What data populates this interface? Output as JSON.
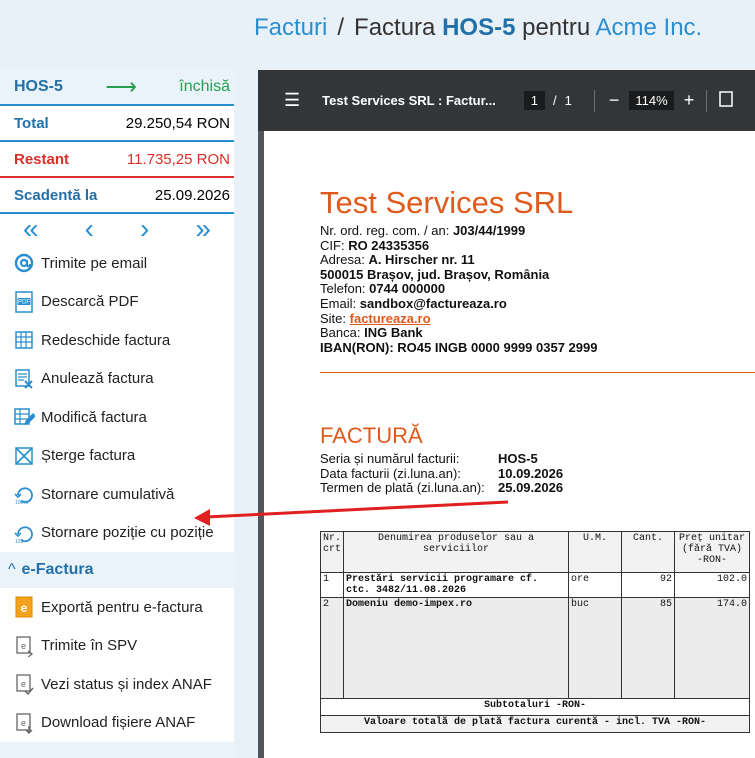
{
  "breadcrumb": {
    "section": "Facturi",
    "separator": "/",
    "prefix": "Factura",
    "number": "HOS-5",
    "middle": "pentru",
    "client": "Acme Inc."
  },
  "summary": {
    "code": "HOS-5",
    "arrow": "⟶",
    "status": "închisă",
    "total_label": "Total",
    "total_value": "29.250,54 RON",
    "rest_label": "Restant",
    "rest_value": "11.735,25 RON",
    "due_label": "Scadentă la",
    "due_value": "25.09.2026"
  },
  "nav": {
    "first": "«",
    "prev": "‹",
    "next": "›",
    "last": "»"
  },
  "actions": [
    {
      "label": "Trimite pe email",
      "icon": "at-icon"
    },
    {
      "label": "Descarcă PDF",
      "icon": "pdf-icon"
    },
    {
      "label": "Redeschide factura",
      "icon": "reopen-icon"
    },
    {
      "label": "Anulează factura",
      "icon": "cancel-invoice-icon"
    },
    {
      "label": "Modifică factura",
      "icon": "edit-invoice-icon"
    },
    {
      "label": "Șterge factura",
      "icon": "delete-icon"
    },
    {
      "label": "Stornare cumulativă",
      "icon": "storno-cumulative-icon"
    },
    {
      "label": "Stornare poziție cu poziție",
      "icon": "storno-line-icon"
    }
  ],
  "efactura": {
    "title": "e-Factura",
    "items": [
      {
        "label": "Exportă pentru e-factura",
        "icon": "export-efactura-icon"
      },
      {
        "label": "Trimite în SPV",
        "icon": "send-spv-icon"
      },
      {
        "label": "Vezi status și index ANAF",
        "icon": "status-anaf-icon"
      },
      {
        "label": "Download fișiere ANAF",
        "icon": "download-anaf-icon"
      }
    ]
  },
  "viewer": {
    "title": "Test Services SRL : Factur...",
    "page_current": "1",
    "page_sep": "/",
    "page_total": "1",
    "zoom": "114%"
  },
  "invoice": {
    "company": "Test Services SRL",
    "reg_label": "Nr. ord. reg. com. / an:",
    "reg_value": "J03/44/1999",
    "cif_label": "CIF:",
    "cif_value": "RO 24335356",
    "addr_label": "Adresa:",
    "addr_value": "A. Hirscher nr. 11",
    "city": "500015 Brașov, jud. Brașov, România",
    "phone_label": "Telefon:",
    "phone_value": "0744 000000",
    "email_label": "Email:",
    "email_value": "sandbox@factureaza.ro",
    "site_label": "Site:",
    "site_value": "factureaza.ro",
    "bank_label": "Banca:",
    "bank_value": "ING Bank",
    "iban_label": "IBAN(RON):",
    "iban_value": "RO45 INGB 0000 9999 0357 2999",
    "doc_title": "FACTURĂ",
    "series_label": "Seria și numărul facturii:",
    "series_value": "HOS-5",
    "date_label": "Data facturii (zi.luna.an):",
    "date_value": "10.09.2026",
    "term_label": "Termen de plată (zi.luna.an):",
    "term_value": "25.09.2026",
    "table": {
      "h_nr": "Nr. crt",
      "h_name": "Denumirea produselor sau a serviciilor",
      "h_um": "U.M.",
      "h_qty": "Cant.",
      "h_price": "Preț unitar (fără TVA) -RON-",
      "rows": [
        {
          "nr": "1",
          "name": "Prestări servicii programare cf. ctc. 3482/11.08.2026",
          "um": "ore",
          "qty": "92",
          "price": "102.0"
        },
        {
          "nr": "2",
          "name": "Domeniu demo-impex.ro",
          "um": "buc",
          "qty": "85",
          "price": "174.0"
        }
      ],
      "subtotal": "Subtotaluri -RON-",
      "grand": "Valoare totală de plată factura curentă - incl. TVA -RON-"
    }
  }
}
